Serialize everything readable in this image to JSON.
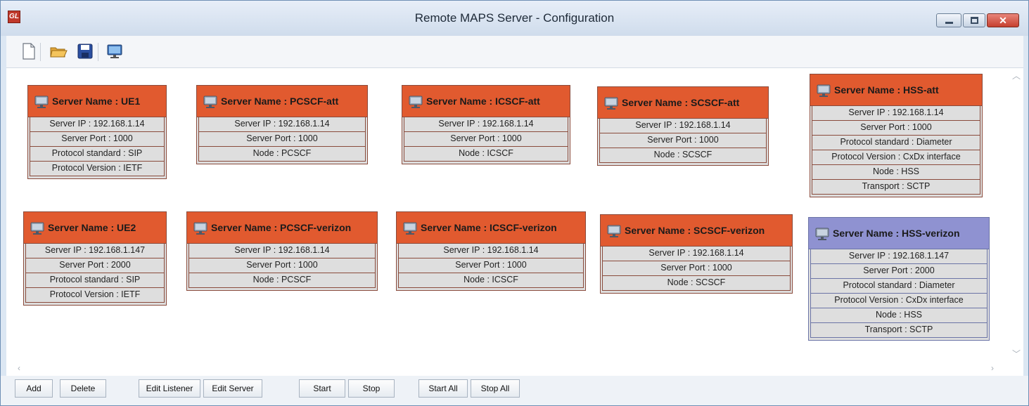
{
  "window": {
    "title": "Remote MAPS Server - Configuration",
    "app_icon_text": "GL",
    "close_glyph": "✕"
  },
  "toolbar": [
    "new-document-icon",
    "open-folder-icon",
    "save-icon",
    "monitor-icon"
  ],
  "servers": [
    {
      "name": "Server Name : UE1",
      "rows": [
        "Server IP : 192.168.1.14",
        "Server Port : 1000",
        "Protocol standard : SIP",
        "Protocol Version : IETF"
      ],
      "selected": false
    },
    {
      "name": "Server Name : PCSCF-att",
      "rows": [
        "Server IP : 192.168.1.14",
        "Server Port : 1000",
        "Node : PCSCF"
      ],
      "selected": false
    },
    {
      "name": "Server Name : ICSCF-att",
      "rows": [
        "Server IP : 192.168.1.14",
        "Server Port : 1000",
        "Node : ICSCF"
      ],
      "selected": false
    },
    {
      "name": "Server Name : SCSCF-att",
      "rows": [
        "Server IP : 192.168.1.14",
        "Server Port : 1000",
        "Node : SCSCF"
      ],
      "selected": false
    },
    {
      "name": "Server Name : HSS-att",
      "rows": [
        "Server IP : 192.168.1.14",
        "Server Port : 1000",
        "Protocol standard : Diameter",
        "Protocol Version : CxDx interface",
        "Node : HSS",
        "Transport : SCTP"
      ],
      "selected": false
    },
    {
      "name": "Server Name : UE2",
      "rows": [
        "Server IP : 192.168.1.147",
        "Server Port : 2000",
        "Protocol standard : SIP",
        "Protocol Version : IETF"
      ],
      "selected": false
    },
    {
      "name": "Server Name : PCSCF-verizon",
      "rows": [
        "Server IP : 192.168.1.14",
        "Server Port : 1000",
        "Node : PCSCF"
      ],
      "selected": false
    },
    {
      "name": "Server Name : ICSCF-verizon",
      "rows": [
        "Server IP : 192.168.1.14",
        "Server Port : 1000",
        "Node : ICSCF"
      ],
      "selected": false
    },
    {
      "name": "Server Name : SCSCF-verizon",
      "rows": [
        "Server IP : 192.168.1.14",
        "Server Port : 1000",
        "Node : SCSCF"
      ],
      "selected": false
    },
    {
      "name": "Server Name : HSS-verizon",
      "rows": [
        "Server IP : 192.168.1.147",
        "Server Port : 2000",
        "Protocol standard : Diameter",
        "Protocol Version : CxDx interface",
        "Node : HSS",
        "Transport : SCTP"
      ],
      "selected": true
    }
  ],
  "buttons": {
    "add": "Add",
    "delete": "Delete",
    "edit_listener": "Edit Listener",
    "edit_server": "Edit Server",
    "start": "Start",
    "stop": "Stop",
    "start_all": "Start All",
    "stop_all": "Stop All"
  },
  "colors": {
    "node_header": "#e15a2f",
    "node_header_selected": "#8f92d1",
    "node_row": "#dedede"
  }
}
